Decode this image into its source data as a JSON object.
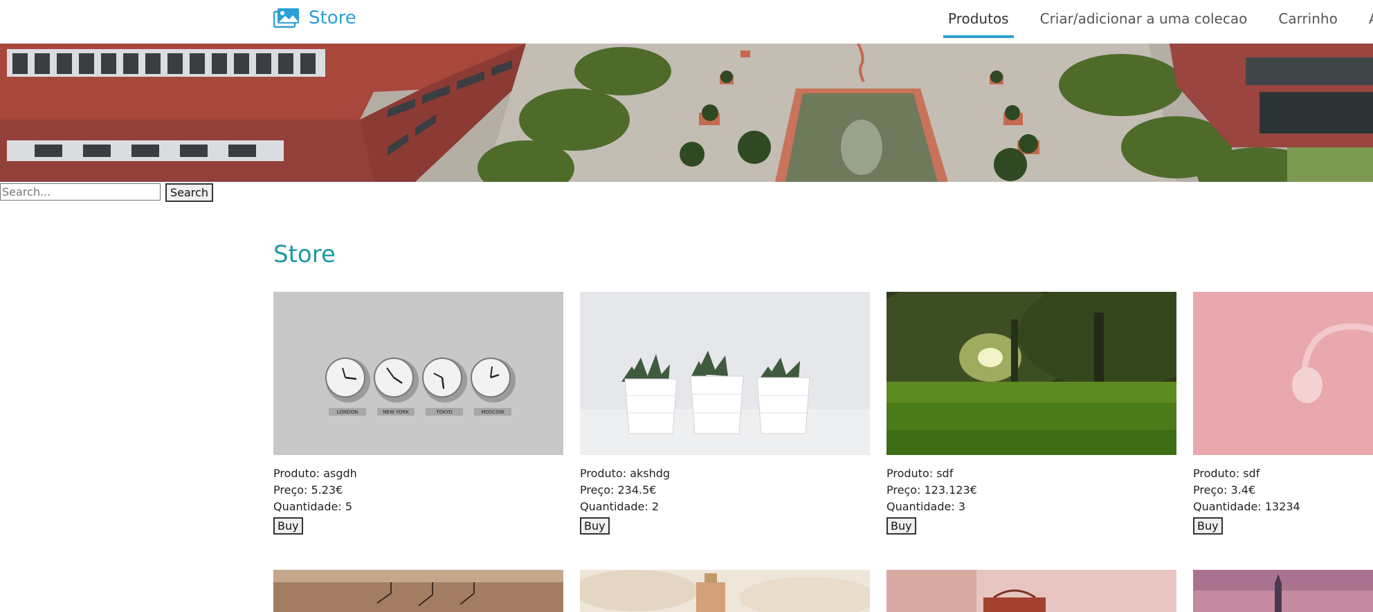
{
  "navbar": {
    "brand": "Store",
    "links": [
      "Produtos",
      "Criar/adicionar a uma colecao",
      "Carrinho",
      "Ab"
    ],
    "active_link": "Produtos",
    "accent_color": "#2b9fd6"
  },
  "search": {
    "placeholder": "Search...",
    "value": "",
    "button_label": "Search"
  },
  "store": {
    "title": "Store",
    "title_color": "#1b9aa3",
    "products": [
      {
        "image": "world-clocks",
        "produto": "Produto: asgdh",
        "preco": "Preço: 5.23€",
        "quantidade": "Quantidade: 5",
        "buy": "Buy",
        "clock_labels": [
          "LONDON",
          "NEW YORK",
          "TOKYO",
          "MOSCOW"
        ]
      },
      {
        "image": "potted-succulents",
        "produto": "Produto: akshdg",
        "preco": "Preço: 234.5€",
        "quantidade": "Quantidade: 2",
        "buy": "Buy"
      },
      {
        "image": "forest-grass",
        "produto": "Produto: sdf",
        "preco": "Preço: 123.123€",
        "quantidade": "Quantidade: 3",
        "buy": "Buy"
      },
      {
        "image": "pink-headphones",
        "produto": "Produto: sdf",
        "preco": "Preço: 3.4€",
        "quantidade": "Quantidade: 13234",
        "buy": "Buy"
      }
    ],
    "next_row_images": [
      "hangers",
      "perfume-on-fur",
      "red-handbag",
      "purple-sunset-city"
    ]
  }
}
